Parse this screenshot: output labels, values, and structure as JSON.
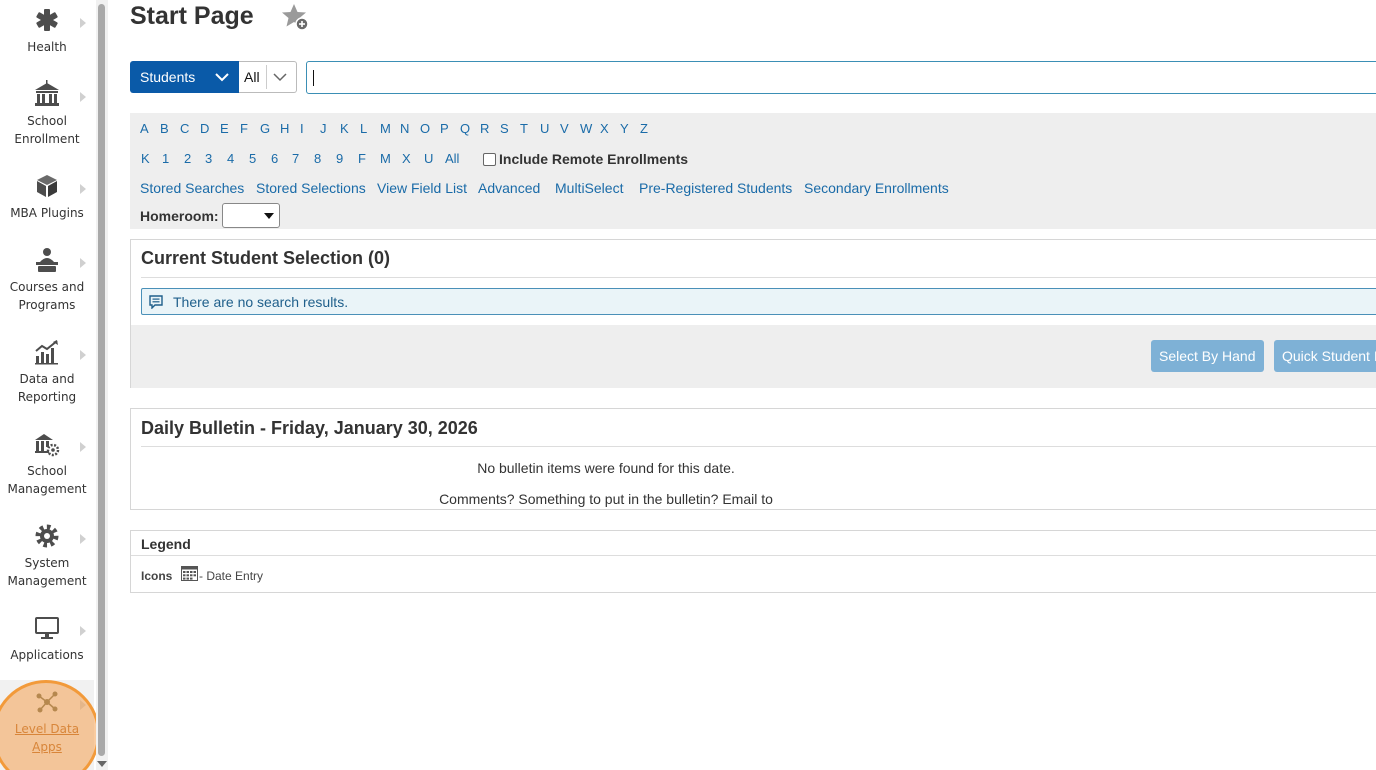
{
  "sidebar": {
    "items": [
      {
        "label_lines": [
          "Health"
        ],
        "icon": "medical-asterisk-icon"
      },
      {
        "label_lines": [
          "School",
          "Enrollment"
        ],
        "icon": "school-building-icon"
      },
      {
        "label_lines": [
          "MBA Plugins"
        ],
        "icon": "cube-icon"
      },
      {
        "label_lines": [
          "Courses and",
          "Programs"
        ],
        "icon": "teacher-desk-icon"
      },
      {
        "label_lines": [
          "Data and",
          "Reporting"
        ],
        "icon": "chart-trend-icon"
      },
      {
        "label_lines": [
          "School",
          "Management"
        ],
        "icon": "school-gear-icon"
      },
      {
        "label_lines": [
          "System",
          "Management"
        ],
        "icon": "gear-icon"
      },
      {
        "label_lines": [
          "Applications"
        ],
        "icon": "monitor-icon"
      },
      {
        "label_lines": [
          "Level Data",
          "Apps"
        ],
        "icon": "network-nodes-icon",
        "active": true
      }
    ],
    "highlight_color": "#f29a3a"
  },
  "header": {
    "title": "Start Page",
    "favorite_icon": "star-add-icon"
  },
  "search": {
    "scope_label": "Students",
    "filter_value": "All",
    "query": ""
  },
  "alpha": {
    "letters": [
      "A",
      "B",
      "C",
      "D",
      "E",
      "F",
      "G",
      "H",
      "I",
      "J",
      "K",
      "L",
      "M",
      "N",
      "O",
      "P",
      "Q",
      "R",
      "S",
      "T",
      "U",
      "V",
      "W",
      "X",
      "Y",
      "Z"
    ],
    "row2": [
      "K",
      "1",
      "2",
      "3",
      "4",
      "5",
      "6",
      "7",
      "8",
      "9",
      "F",
      "M",
      "X",
      "U",
      "All"
    ],
    "remote_label": "Include Remote Enrollments",
    "links": [
      "Stored Searches",
      "Stored Selections",
      "View Field List",
      "Advanced",
      "MultiSelect",
      "Pre-Registered Students",
      "Secondary Enrollments"
    ],
    "homeroom_label": "Homeroom:"
  },
  "selection": {
    "title": "Current Student Selection (0)",
    "empty_message": "There are no search results.",
    "buttons": {
      "select_by_hand": "Select By Hand",
      "quick_student": "Quick Student I"
    }
  },
  "bulletin": {
    "title": "Daily Bulletin - Friday, January 30, 2026",
    "empty_message": "No bulletin items were found for this date.",
    "comments": "Comments? Something to put in the bulletin? Email to"
  },
  "legend": {
    "title": "Legend",
    "icons_label": "Icons",
    "date_entry_label": "- Date Entry"
  },
  "colors": {
    "primary_blue": "#0a5aa8",
    "link_blue": "#1a6ba8",
    "button_blue": "#7eb1d6",
    "panel_gray": "#eeeeee"
  }
}
